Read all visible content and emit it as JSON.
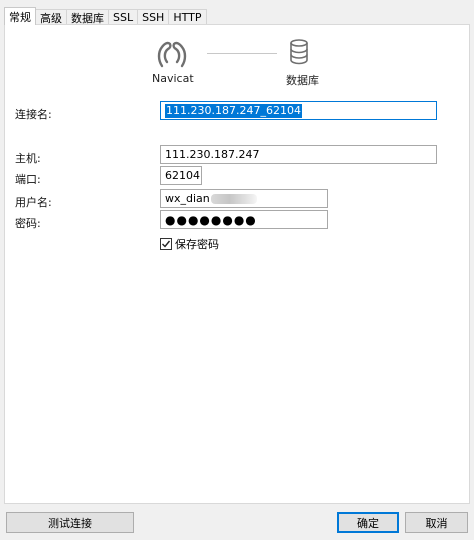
{
  "tabs": [
    {
      "label": "常规",
      "active": true
    },
    {
      "label": "高级"
    },
    {
      "label": "数据库"
    },
    {
      "label": "SSL"
    },
    {
      "label": "SSH"
    },
    {
      "label": "HTTP"
    }
  ],
  "diagram": {
    "client_label": "Navicat",
    "client_icon": "navicat-logo-icon",
    "server_label": "数据库",
    "server_icon": "database-icon"
  },
  "form": {
    "connection_name_label": "连接名:",
    "connection_name_value": "111.230.187.247_62104",
    "host_label": "主机:",
    "host_value": "111.230.187.247",
    "port_label": "端口:",
    "port_value": "62104",
    "username_label": "用户名:",
    "username_value": "wx_dian",
    "password_label": "密码:",
    "password_value": "●●●●●●●●",
    "save_password_label": "保存密码",
    "save_password_checked": true
  },
  "buttons": {
    "test_connection": "测试连接",
    "ok": "确定",
    "cancel": "取消"
  },
  "colors": {
    "accent": "#0078d7",
    "panel_bg": "#ffffff",
    "window_bg": "#f0f0f0"
  }
}
